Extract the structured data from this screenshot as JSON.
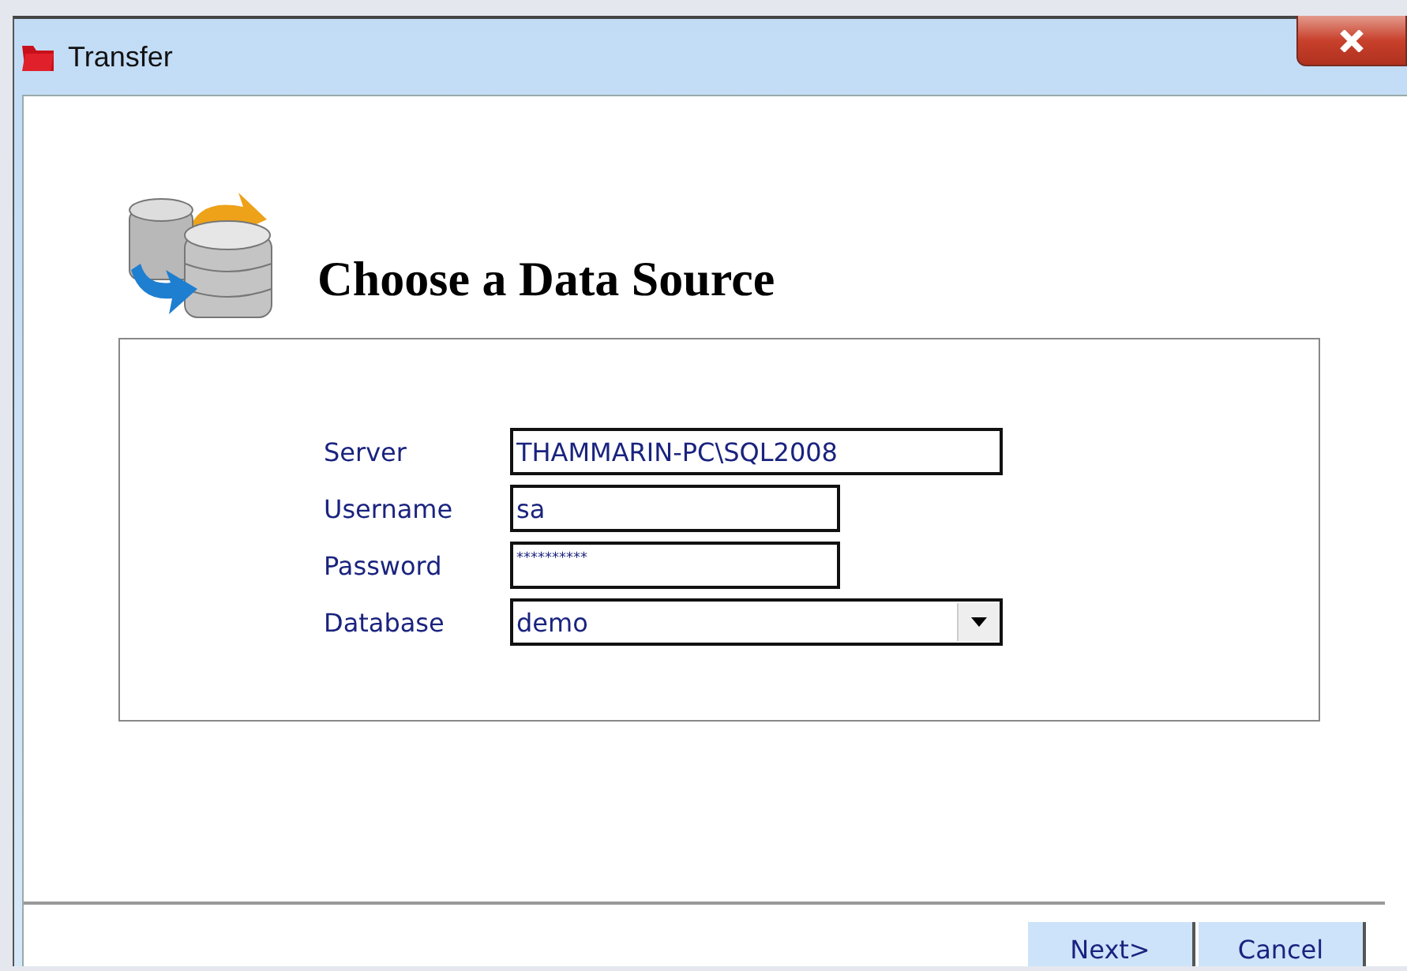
{
  "window": {
    "title": "Transfer"
  },
  "heading": "Choose a Data Source",
  "fields": [
    {
      "kind": "text",
      "label": "Server",
      "value": "THAMMARIN-PC\\SQL2008"
    },
    {
      "kind": "text",
      "label": "Username",
      "value": "sa"
    },
    {
      "kind": "password",
      "label": "Password",
      "value": "**********"
    },
    {
      "kind": "select",
      "label": "Database",
      "value": "demo"
    }
  ],
  "buttons": [
    "Next>",
    "Cancel"
  ]
}
